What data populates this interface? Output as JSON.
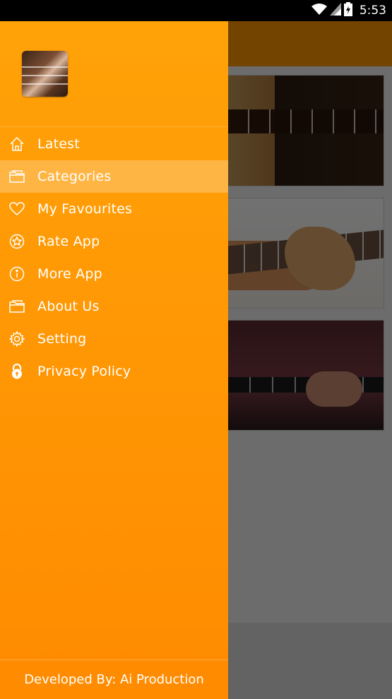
{
  "status_bar": {
    "time": "5:53",
    "icons": [
      "wifi-icon",
      "cell-signal-icon",
      "battery-icon"
    ]
  },
  "drawer": {
    "header": {
      "avatar": "guitar-thumbnail"
    },
    "menu": [
      {
        "label": "Latest",
        "icon": "home-icon",
        "active": false
      },
      {
        "label": "Categories",
        "icon": "folder-icon",
        "active": true
      },
      {
        "label": "My Favourites",
        "icon": "heart-icon",
        "active": false
      },
      {
        "label": "Rate App",
        "icon": "star-badge-icon",
        "active": false
      },
      {
        "label": "More App",
        "icon": "info-icon",
        "active": false
      },
      {
        "label": "About Us",
        "icon": "folder-icon",
        "active": false
      },
      {
        "label": "Setting",
        "icon": "gear-icon",
        "active": false
      },
      {
        "label": "Privacy Policy",
        "icon": "lock-icon",
        "active": false
      }
    ],
    "footer": "Developed By: Ai Production"
  },
  "colors": {
    "drawer_top": "#ffa208",
    "drawer_bottom": "#ff8b00",
    "toolbar": "#ff9800",
    "active_item": "rgba(255,255,255,0.25)"
  }
}
